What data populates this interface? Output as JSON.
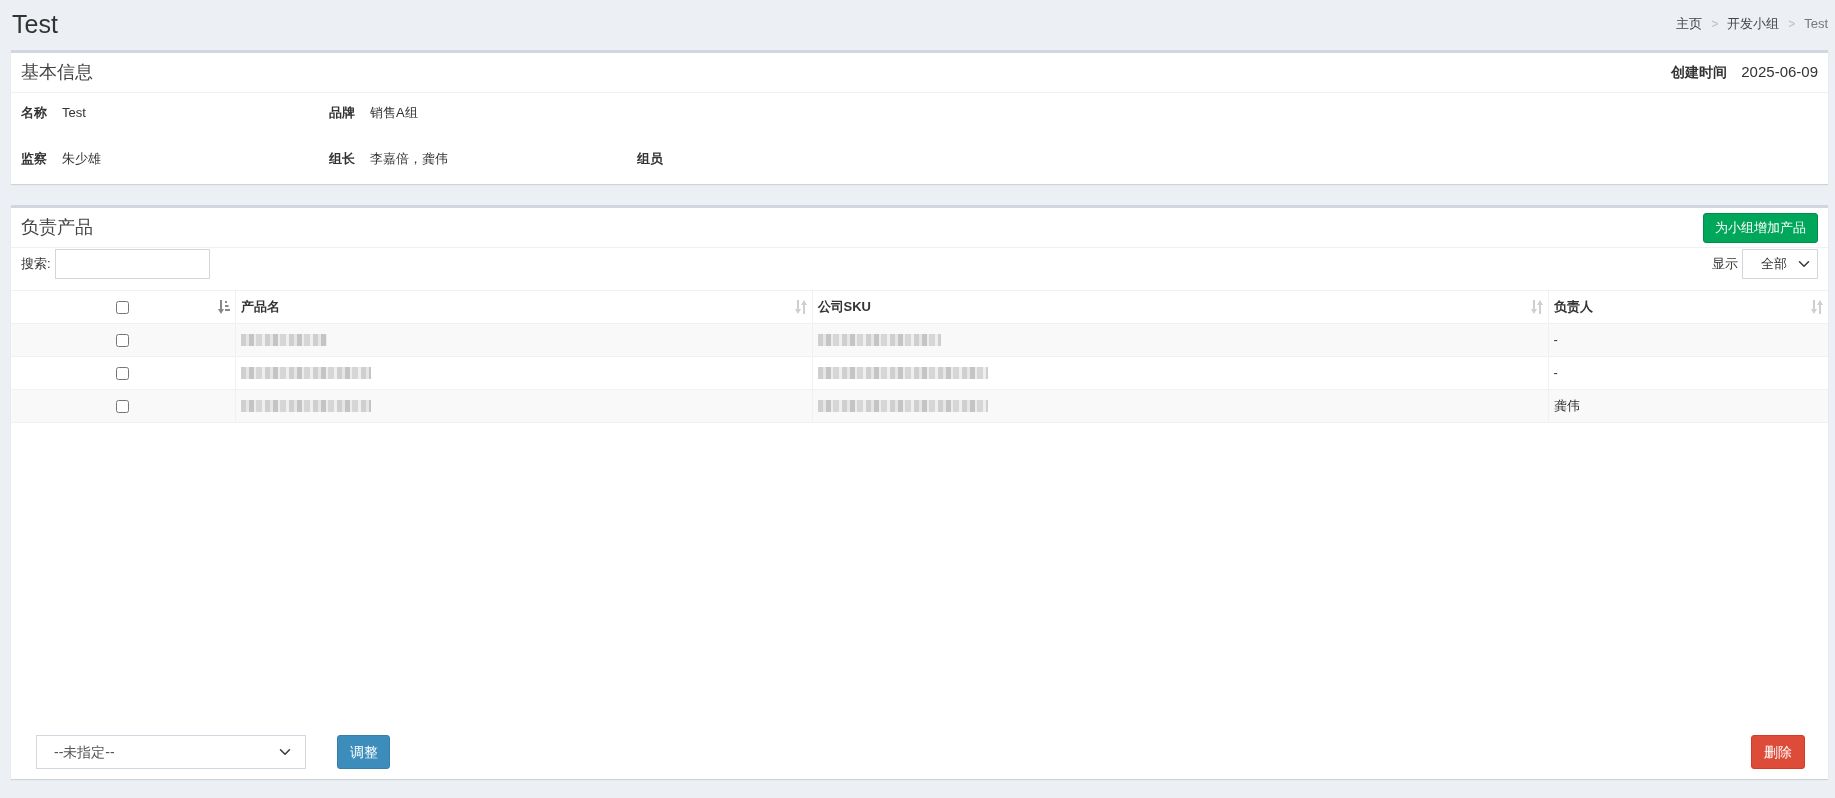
{
  "page": {
    "title": "Test"
  },
  "breadcrumb": [
    {
      "label": "主页",
      "current": false
    },
    {
      "separator": ">",
      "label": "开发小组",
      "current": false
    },
    {
      "separator": ">",
      "label": "Test",
      "current": true
    }
  ],
  "info_panel": {
    "title": "基本信息",
    "created": {
      "label": "创建时间",
      "value": "2025-06-09"
    },
    "rows": [
      [
        {
          "label": "名称",
          "value": "Test"
        },
        {
          "label": "品牌",
          "value": "销售A组"
        }
      ],
      [
        {
          "label": "监察",
          "value": "朱少雄"
        },
        {
          "label": "组长",
          "value": "李嘉倍，龚伟"
        },
        {
          "label": "组员"
        }
      ]
    ]
  },
  "products_panel": {
    "title": "负责产品",
    "add_button": "为小组增加产品",
    "search": {
      "label": "搜索:"
    },
    "page_length": {
      "label": "显示",
      "value": "全部"
    },
    "table": {
      "columns": [
        {
          "kind": "checkbox",
          "checked": false,
          "sorted": true
        },
        {
          "kind": "text",
          "label": "产品名",
          "sorted": false
        },
        {
          "kind": "text",
          "label": "公司SKU",
          "sorted": false
        },
        {
          "kind": "text",
          "label": "负责人",
          "sorted": false
        }
      ],
      "rows": [
        {
          "checked": false,
          "product_blurred": true,
          "sku_blurred": true,
          "owner": "-"
        },
        {
          "checked": false,
          "product_blurred": true,
          "sku_blurred": true,
          "owner": "-"
        },
        {
          "checked": false,
          "product_blurred": true,
          "sku_blurred": true,
          "owner": "龚伟"
        }
      ]
    },
    "footer": {
      "assignee_select": "--未指定--",
      "adjust_button": "调整",
      "delete_button": "删除"
    }
  }
}
